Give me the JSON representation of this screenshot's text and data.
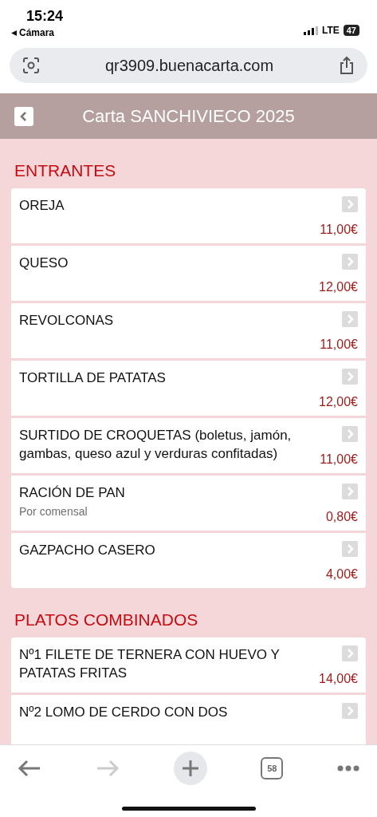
{
  "status_bar": {
    "time": "15:24",
    "back_label": "Cámara",
    "network": "LTE",
    "battery": "47"
  },
  "address_bar": {
    "url": "qr3909.buenacarta.com"
  },
  "header": {
    "title": "Carta SANCHIVIECO 2025"
  },
  "sections": [
    {
      "title": "ENTRANTES",
      "items": [
        {
          "name": "OREJA",
          "price": "11,00€"
        },
        {
          "name": "QUESO",
          "price": "12,00€"
        },
        {
          "name": "REVOLCONAS",
          "price": "11,00€"
        },
        {
          "name": "TORTILLA DE PATATAS",
          "price": "12,00€"
        },
        {
          "name": "SURTIDO DE CROQUETAS (boletus, jamón, gambas, queso azul y verduras confitadas)",
          "price": "11,00€"
        },
        {
          "name": "RACIÓN DE PAN",
          "note": "Por comensal",
          "price": "0,80€"
        },
        {
          "name": "GAZPACHO CASERO",
          "price": "4,00€"
        }
      ]
    },
    {
      "title": "PLATOS COMBINADOS",
      "items": [
        {
          "name": "Nº1 FILETE DE TERNERA CON HUEVO Y PATATAS FRITAS",
          "price": "14,00€"
        },
        {
          "name": "Nº2 LOMO DE CERDO CON DOS"
        }
      ]
    }
  ],
  "toolbar": {
    "back_disabled": false,
    "forward_disabled": true,
    "tab_count": "58"
  }
}
